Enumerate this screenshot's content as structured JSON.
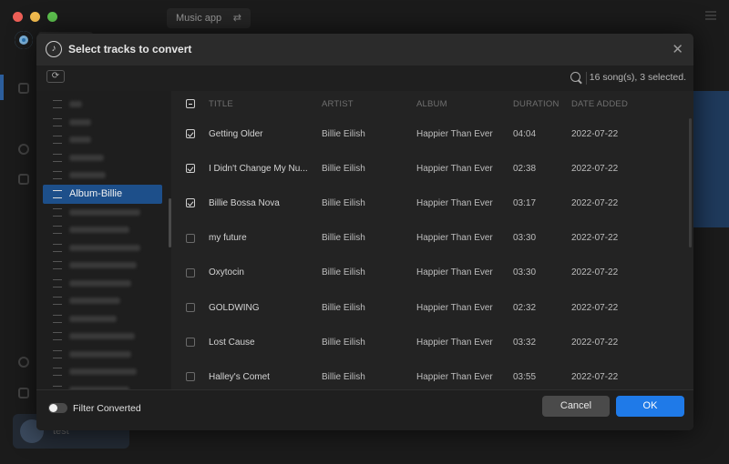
{
  "background": {
    "source_label": "Music app",
    "user_name": "test"
  },
  "dialog": {
    "title": "Select tracks to convert",
    "song_count": "16 song(s), 3 selected."
  },
  "playlists": {
    "active_label": "Album-Billie",
    "blurred_widths_before": [
      14,
      24,
      24,
      38,
      40
    ],
    "blurred_widths_after": [
      78,
      66,
      78,
      74,
      68,
      56,
      52,
      72,
      68,
      74,
      66,
      78
    ]
  },
  "table": {
    "headers": {
      "title": "TITLE",
      "artist": "ARTIST",
      "album": "ALBUM",
      "duration": "DURATION",
      "date": "DATE ADDED"
    },
    "rows": [
      {
        "checked": true,
        "title": "Getting Older",
        "artist": "Billie Eilish",
        "album": "Happier Than Ever",
        "duration": "04:04",
        "date": "2022-07-22"
      },
      {
        "checked": true,
        "title": "I Didn't Change My Nu...",
        "artist": "Billie Eilish",
        "album": "Happier Than Ever",
        "duration": "02:38",
        "date": "2022-07-22"
      },
      {
        "checked": true,
        "title": "Billie Bossa Nova",
        "artist": "Billie Eilish",
        "album": "Happier Than Ever",
        "duration": "03:17",
        "date": "2022-07-22"
      },
      {
        "checked": false,
        "title": "my future",
        "artist": "Billie Eilish",
        "album": "Happier Than Ever",
        "duration": "03:30",
        "date": "2022-07-22"
      },
      {
        "checked": false,
        "title": "Oxytocin",
        "artist": "Billie Eilish",
        "album": "Happier Than Ever",
        "duration": "03:30",
        "date": "2022-07-22"
      },
      {
        "checked": false,
        "title": "GOLDWING",
        "artist": "Billie Eilish",
        "album": "Happier Than Ever",
        "duration": "02:32",
        "date": "2022-07-22"
      },
      {
        "checked": false,
        "title": "Lost Cause",
        "artist": "Billie Eilish",
        "album": "Happier Than Ever",
        "duration": "03:32",
        "date": "2022-07-22"
      },
      {
        "checked": false,
        "title": "Halley's Comet",
        "artist": "Billie Eilish",
        "album": "Happier Than Ever",
        "duration": "03:55",
        "date": "2022-07-22"
      }
    ]
  },
  "footer": {
    "filter_label": "Filter Converted",
    "filter_on": false,
    "cancel_label": "Cancel",
    "ok_label": "OK"
  },
  "colors": {
    "accent": "#1f7ae8",
    "active_playlist": "#1d4f8a"
  }
}
